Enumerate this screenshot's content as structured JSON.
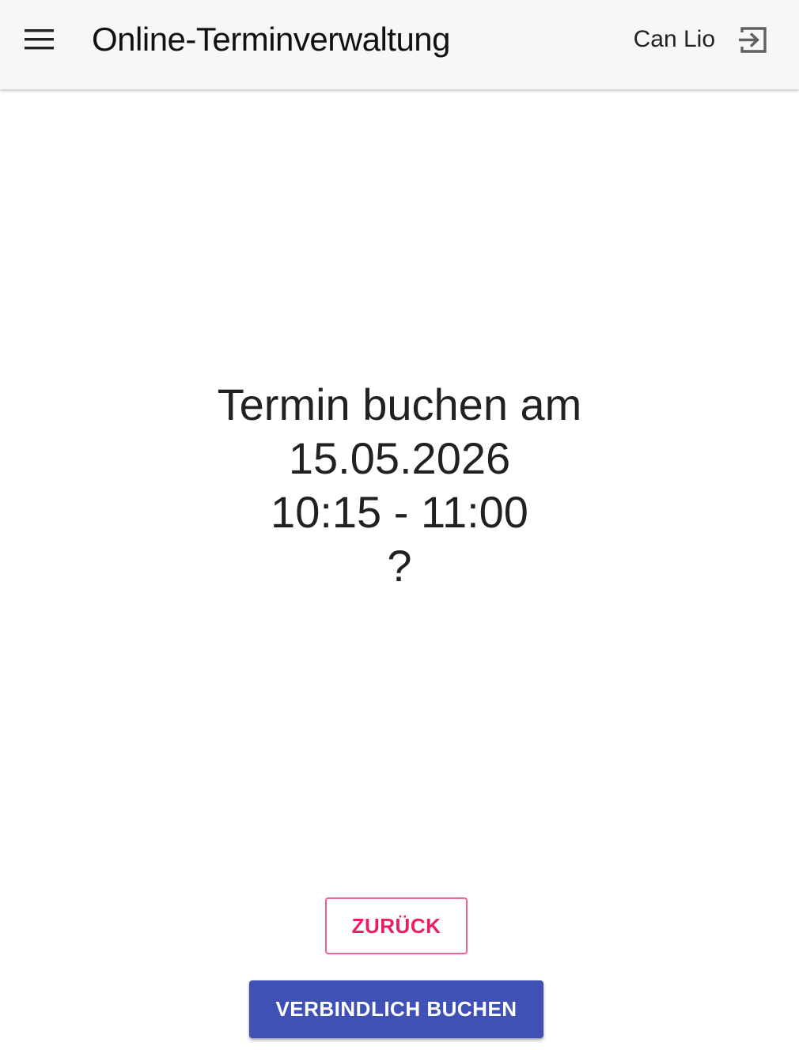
{
  "header": {
    "menu_icon": "hamburger-menu-icon",
    "title": "Online-Terminverwaltung",
    "user_name": "Can Lio",
    "logout_icon": "logout-icon"
  },
  "question": {
    "line1": "Termin buchen am",
    "date": "15.05.2026",
    "time_range": "10:15 - 11:00",
    "mark": "?"
  },
  "actions": {
    "back_label": "ZURÜCK",
    "book_label": "VERBINDLICH BUCHEN"
  },
  "colors": {
    "app_bar_bg": "#f7f7f7",
    "primary": "#3f51b5",
    "accent": "#e91e63"
  }
}
